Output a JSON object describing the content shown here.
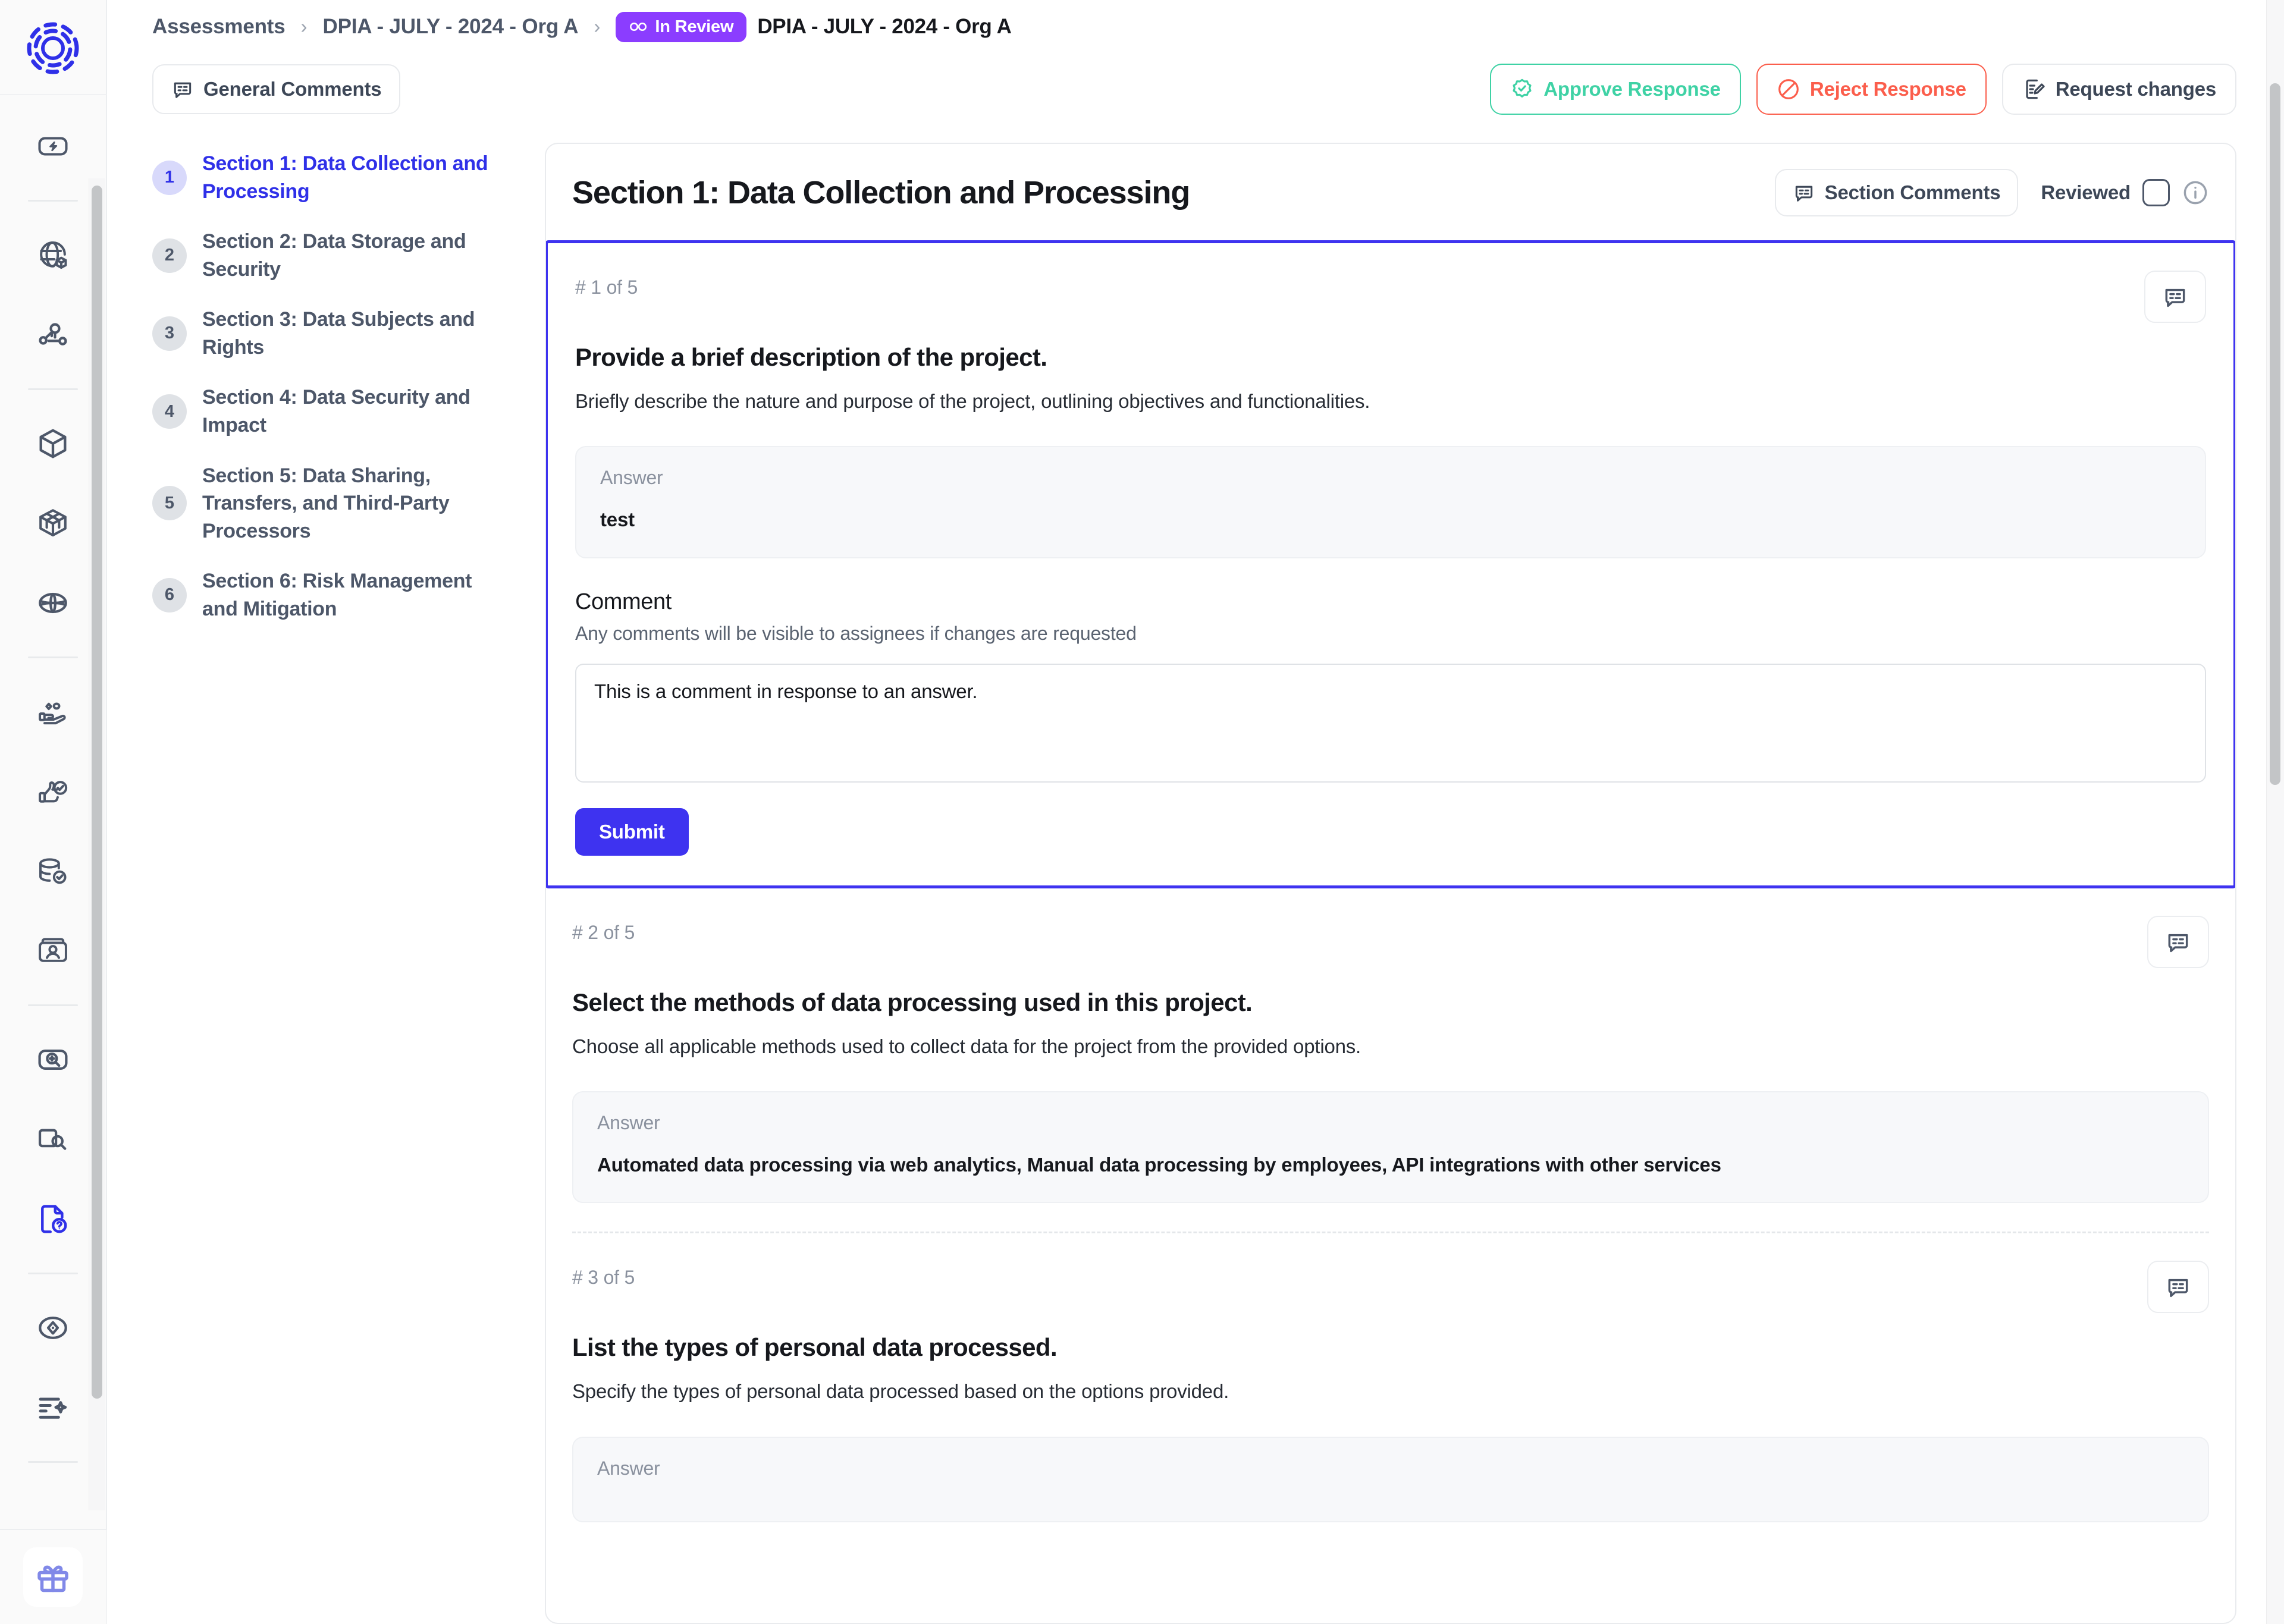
{
  "breadcrumb": {
    "items": [
      "Assessments",
      "DPIA - JULY - 2024 - Org A"
    ],
    "status_badge": "In Review",
    "current": "DPIA - JULY - 2024 - Org A",
    "separator": "›",
    "badge_color": "#8B3DFF"
  },
  "toolbar": {
    "general_comments": "General Comments",
    "approve": "Approve Response",
    "reject": "Reject Response",
    "request_changes": "Request changes",
    "approve_color": "#3fd2a5",
    "reject_color": "#fb5e4c"
  },
  "sidebar": {
    "items": [
      {
        "name": "automation-icon"
      },
      {
        "name": "globe-cube-icon"
      },
      {
        "name": "network-nodes-icon"
      },
      {
        "name": "cube-icon"
      },
      {
        "name": "layered-cube-icon"
      },
      {
        "name": "globe-icon"
      },
      {
        "name": "hand-data-icon"
      },
      {
        "name": "thumbs-up-check-icon"
      },
      {
        "name": "database-check-icon"
      },
      {
        "name": "id-card-icon"
      },
      {
        "name": "image-search-icon"
      },
      {
        "name": "document-search-icon"
      },
      {
        "name": "assessments-icon",
        "active": true
      },
      {
        "name": "compass-icon"
      },
      {
        "name": "ai-list-icon"
      }
    ],
    "gift": "gift-icon",
    "active_color": "#2f30e8"
  },
  "section_nav": [
    {
      "num": "1",
      "label": "Section 1: Data Collection and Processing",
      "active": true
    },
    {
      "num": "2",
      "label": "Section 2: Data Storage and Security",
      "active": false
    },
    {
      "num": "3",
      "label": "Section 3: Data Subjects and Rights",
      "active": false
    },
    {
      "num": "4",
      "label": "Section 4: Data Security and Impact",
      "active": false
    },
    {
      "num": "5",
      "label": "Section 5: Data Sharing, Transfers, and Third-Party Processors",
      "active": false
    },
    {
      "num": "6",
      "label": "Section 6: Risk Management and Mitigation",
      "active": false
    }
  ],
  "panel": {
    "title": "Section 1: Data Collection and Processing",
    "section_comments": "Section Comments",
    "reviewed_label": "Reviewed",
    "reviewed_checked": false
  },
  "questions": [
    {
      "counter": "# 1 of 5",
      "title": "Provide a brief description of the project.",
      "description": "Briefly describe the nature and purpose of the project, outlining objectives and functionalities.",
      "answer_label": "Answer",
      "answer_value": "test",
      "comment_label": "Comment",
      "comment_hint": "Any comments will be visible to assignees if changes are requested",
      "comment_value": "This is a comment in response to an answer.",
      "submit_label": "Submit",
      "focused": true
    },
    {
      "counter": "# 2 of 5",
      "title": "Select the methods of data processing used in this project.",
      "description": "Choose all applicable methods used to collect data for the project from the provided options.",
      "answer_label": "Answer",
      "answer_value": "Automated data processing via web analytics, Manual data processing by employees, API integrations with other services",
      "focused": false
    },
    {
      "counter": "# 3 of 5",
      "title": "List the types of personal data processed.",
      "description": "Specify the types of personal data processed based on the options provided.",
      "answer_label": "Answer",
      "answer_value": "",
      "focused": false
    }
  ]
}
